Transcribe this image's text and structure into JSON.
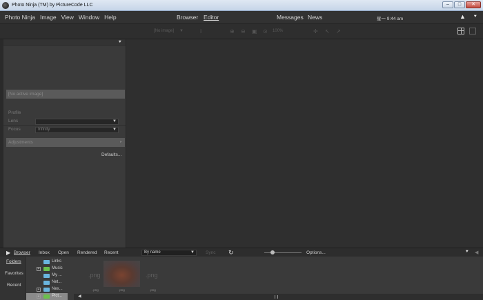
{
  "window": {
    "title": "Photo Ninja (TM) by PictureCode LLC",
    "min": "–",
    "max": "□",
    "close": "✕"
  },
  "menu": {
    "items": [
      "Photo Ninja",
      "Image",
      "View",
      "Window",
      "Help"
    ],
    "modes": [
      "Browser",
      "Editor"
    ],
    "links": [
      "Messages",
      "News"
    ],
    "clock": "星一 9:44 am",
    "collapse": "▲",
    "pin": "⯆"
  },
  "toolbar": {
    "image_select": "[No image]",
    "zoom": "100%"
  },
  "left_panel": {
    "pin": "⯆",
    "active_image": "[No active image]",
    "profile_label": "Profile",
    "lens_label": "Lens",
    "lens_value": "",
    "focus_label": "Focus",
    "focus_value": "Infinity",
    "adjustments": "Adjustments",
    "defaults": "Defaults..."
  },
  "browser": {
    "tabs": [
      "Browser",
      "Inbox",
      "Open",
      "Rendered",
      "Recent"
    ],
    "sort": "By name",
    "sync": "Sync",
    "options": "Options...",
    "side_tabs": [
      "Folders",
      "Favorites",
      "Recent"
    ],
    "tree": [
      {
        "label": "Links",
        "expander": "",
        "green": false
      },
      {
        "label": "Music",
        "expander": "+",
        "green": true
      },
      {
        "label": "My ...",
        "expander": "",
        "green": false
      },
      {
        "label": "Net...",
        "expander": "",
        "green": false
      },
      {
        "label": "Nex...",
        "expander": "+",
        "green": false
      },
      {
        "label": "Pict...",
        "expander": "+",
        "green": true
      }
    ],
    "thumbs": [
      ".png",
      ".png"
    ],
    "captions": [
      ".png",
      ".png",
      ".png"
    ]
  }
}
